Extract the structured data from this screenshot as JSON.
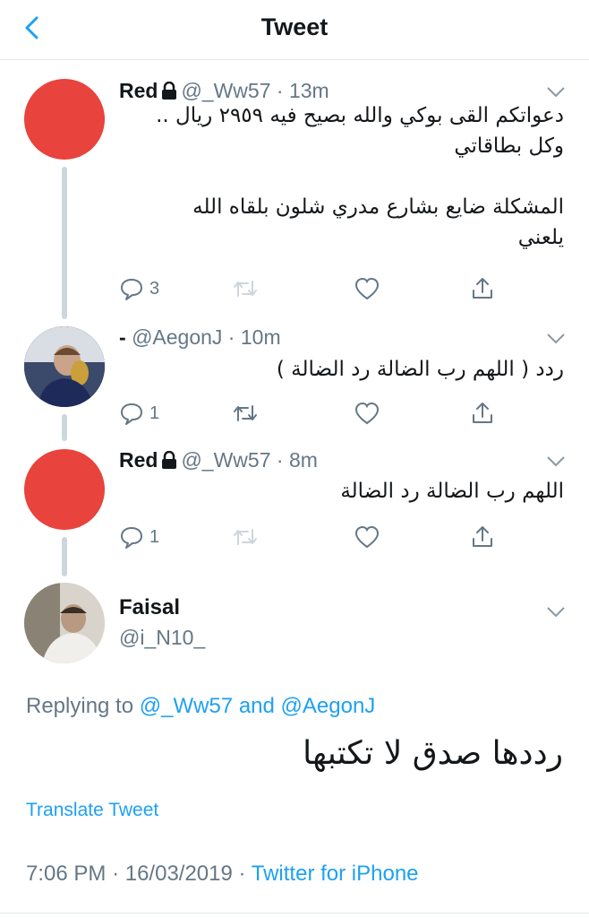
{
  "nav": {
    "title": "Tweet",
    "back_icon": "chevron-left-icon"
  },
  "colors": {
    "accent": "#1da1f2",
    "muted": "#657786",
    "avatar_red": "#e8433c"
  },
  "thread": [
    {
      "name": "Red",
      "locked": true,
      "handle": "@_Ww57",
      "time": "13m",
      "text_lines": [
        "دعواتكم القى بوكي والله بصيح فيه ٢٩٥٩ ريال ..",
        "وكل بطاقاتي",
        "",
        "المشكلة ضايع بشارع مدري شلون بلقاه الله",
        "يلعني"
      ],
      "reply_count": "3"
    },
    {
      "name": "-",
      "locked": false,
      "handle": "@AegonJ",
      "time": "10m",
      "text_lines": [
        "ردد ( اللهم رب الضالة رد الضالة )"
      ],
      "reply_count": "1"
    },
    {
      "name": "Red",
      "locked": true,
      "handle": "@_Ww57",
      "time": "8m",
      "text_lines": [
        "اللهم رب الضالة رد الضالة"
      ],
      "reply_count": "1"
    }
  ],
  "main": {
    "name": "Faisal",
    "handle": "@i_N10_",
    "replying_prefix": "Replying to",
    "replying_user1": "@_Ww57",
    "replying_and": "and",
    "replying_user2": "@AegonJ",
    "text": "رددها صدق لا تكتبها",
    "translate": "Translate Tweet",
    "time": "7:06 PM",
    "date": "16/03/2019",
    "source": "Twitter for iPhone"
  }
}
